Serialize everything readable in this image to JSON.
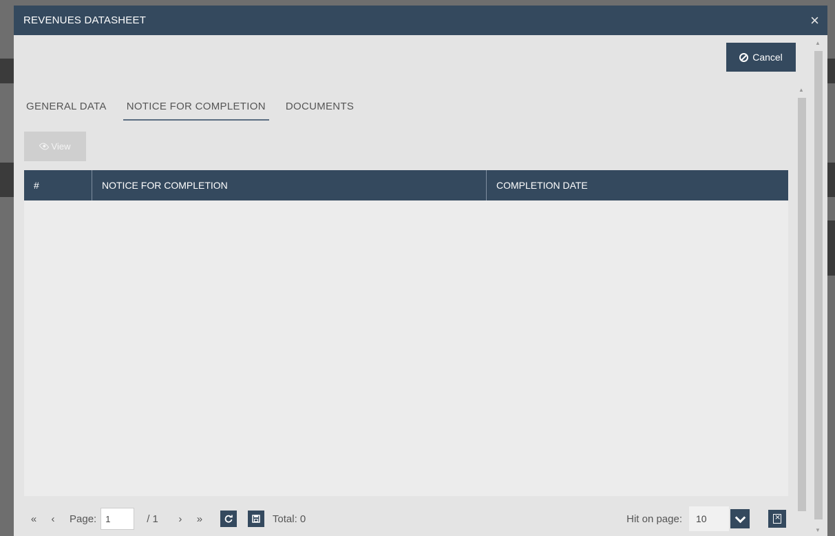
{
  "modal": {
    "title": "REVENUES DATASHEET",
    "close_glyph": "×"
  },
  "toolbar": {
    "cancel_label": "Cancel",
    "view_label": "View"
  },
  "tabs": [
    {
      "label": "GENERAL DATA",
      "active": false
    },
    {
      "label": "NOTICE FOR COMPLETION",
      "active": true
    },
    {
      "label": "DOCUMENTS",
      "active": false
    }
  ],
  "grid": {
    "columns": [
      "#",
      "NOTICE FOR COMPLETION",
      "COMPLETION DATE"
    ],
    "rows": []
  },
  "pager": {
    "first": "«",
    "prev": "‹",
    "page_label": "Page:",
    "page_value": "1",
    "of_pages": "/ 1",
    "next": "›",
    "last": "»",
    "total_label": "Total:  0",
    "hit_label": "Hit on page:",
    "hit_value": "10"
  },
  "colors": {
    "header": "#34495e",
    "modal_bg": "#e4e4e4",
    "grid_bg": "#ececec"
  },
  "icons": [
    "close-icon",
    "ban-icon",
    "eye-icon",
    "refresh-icon",
    "save-icon",
    "chevron-down-icon",
    "excel-icon"
  ]
}
